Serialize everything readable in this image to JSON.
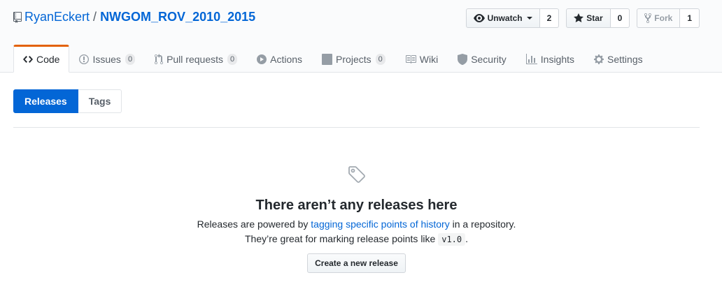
{
  "repo": {
    "owner": "RyanEckert",
    "separator": "/",
    "name": "NWGOM_ROV_2010_2015"
  },
  "actions": {
    "watch": {
      "label": "Unwatch",
      "count": "2"
    },
    "star": {
      "label": "Star",
      "count": "0"
    },
    "fork": {
      "label": "Fork",
      "count": "1"
    }
  },
  "tabs": [
    {
      "label": "Code",
      "icon": "code-icon"
    },
    {
      "label": "Issues",
      "counter": "0",
      "icon": "issue-icon"
    },
    {
      "label": "Pull requests",
      "counter": "0",
      "icon": "pull-request-icon"
    },
    {
      "label": "Actions",
      "icon": "play-icon"
    },
    {
      "label": "Projects",
      "counter": "0",
      "icon": "project-icon"
    },
    {
      "label": "Wiki",
      "icon": "book-icon"
    },
    {
      "label": "Security",
      "icon": "shield-icon"
    },
    {
      "label": "Insights",
      "icon": "graph-icon"
    },
    {
      "label": "Settings",
      "icon": "gear-icon"
    }
  ],
  "subnav": {
    "releases": "Releases",
    "tags": "Tags"
  },
  "blankslate": {
    "heading": "There aren’t any releases here",
    "line1_prefix": "Releases are powered by ",
    "line1_link": "tagging specific points of history",
    "line1_suffix": " in a repository.",
    "line2_prefix": "They’re great for marking release points like ",
    "line2_code": "v1.0",
    "line2_suffix": ".",
    "button": "Create a new release"
  },
  "colors": {
    "accent": "#0366d6",
    "selected_tab_border": "#e36209",
    "icon": "#586069"
  }
}
